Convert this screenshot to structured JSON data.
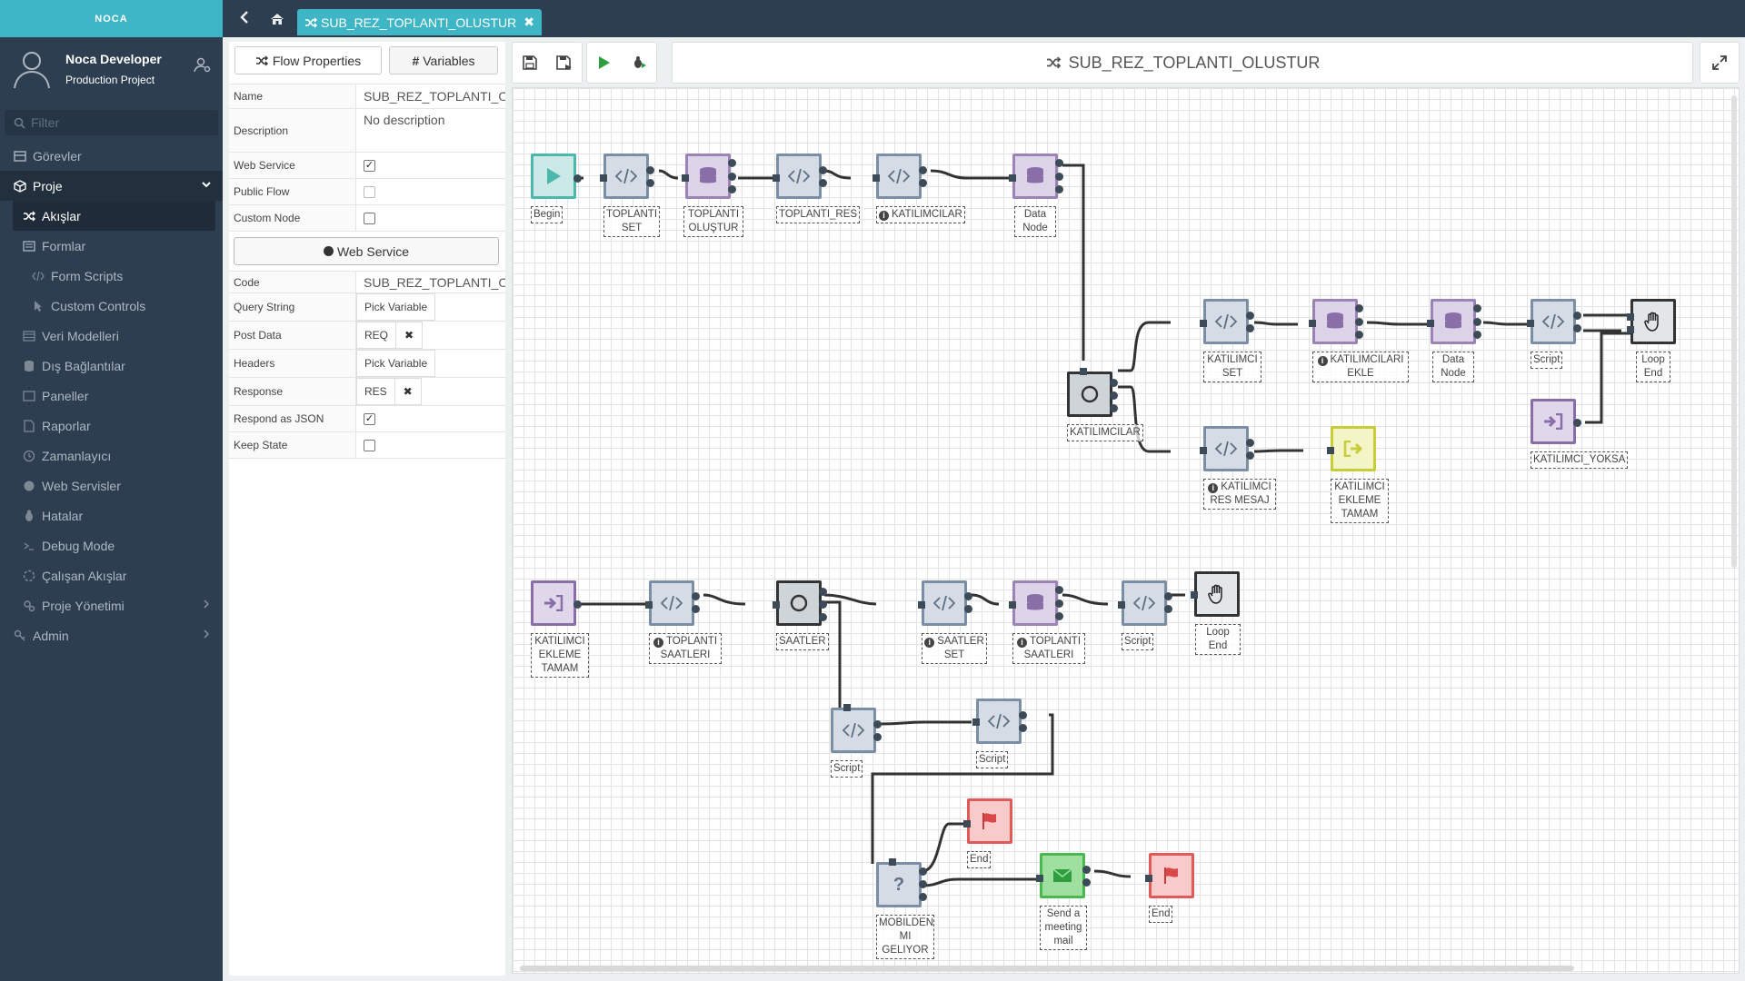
{
  "brand": "NOCA",
  "user": {
    "name": "Noca Developer",
    "project": "Production Project"
  },
  "filter_placeholder": "Filter",
  "nav": {
    "gorevler": "Görevler",
    "proje": "Proje",
    "akislar": "Akışlar",
    "formlar": "Formlar",
    "form_scripts": "Form Scripts",
    "custom_controls": "Custom Controls",
    "veri_modelleri": "Veri Modelleri",
    "dis_baglantilar": "Dış Bağlantılar",
    "paneller": "Paneller",
    "raporlar": "Raporlar",
    "zamanlayici": "Zamanlayıcı",
    "web_servisler": "Web Servisler",
    "hatalar": "Hatalar",
    "debug_mode": "Debug Mode",
    "calisan_akislar": "Çalışan Akışlar",
    "proje_yonetimi": "Proje Yönetimi",
    "admin": "Admin"
  },
  "tab": {
    "label": "SUB_REZ_TOPLANTI_OLUSTUR"
  },
  "props": {
    "tab_flow": "Flow Properties",
    "tab_vars": "Variables",
    "name_label": "Name",
    "name_value": "SUB_REZ_TOPLANTI_OLUSTUR",
    "desc_label": "Description",
    "desc_value": "No description",
    "web_service_label": "Web Service",
    "web_service_checked": true,
    "public_flow_label": "Public Flow",
    "public_flow_checked": false,
    "custom_node_label": "Custom Node",
    "custom_node_checked": false,
    "ws_button": "Web Service",
    "code_label": "Code",
    "code_value": "SUB_REZ_TOPLANTI_OLUSTUR",
    "query_label": "Query String",
    "query_value": "Pick Variable",
    "post_label": "Post Data",
    "post_value": "REQ",
    "headers_label": "Headers",
    "headers_value": "Pick Variable",
    "response_label": "Response",
    "response_value": "RES",
    "respond_json_label": "Respond as JSON",
    "respond_json_checked": true,
    "keep_state_label": "Keep State",
    "keep_state_checked": false
  },
  "flow_title": "SUB_REZ_TOPLANTI_OLUSTUR",
  "nodes": {
    "begin": "Begin",
    "toplanti_set": "TOPLANTI SET",
    "toplanti_olustur": "TOPLANTI OLUŞTUR",
    "toplanti_res": "TOPLANTI_RES",
    "katilimcilar_script": "KATILIMCILAR",
    "data_node_1": "Data Node",
    "katilimcilar_loop": "KATILIMCILAR",
    "katilimci_set": "KATILIMCI SET",
    "katilimcilari_ekle": "KATILIMCILARI EKLE",
    "data_node_2": "Data Node",
    "script_1": "Script",
    "loop_end_1": "Loop End",
    "katilimci_yoksa": "KATILIMCI_YOKSA",
    "katilimci_res_mesaj": "KATILIMCI RES MESAJ",
    "katilimci_ekleme_tamam_exit": "KATILIMCI EKLEME TAMAM",
    "katilimci_ekleme_tamam_enter": "KATILIMCI EKLEME TAMAM",
    "toplanti_saatleri_script": "TOPLANTI SAATLERI",
    "saatler": "SAATLER",
    "saatler_set": "SAATLER SET",
    "toplanti_saatleri_data": "TOPLANTI SAATLERI",
    "script_2": "Script",
    "loop_end_2": "Loop End",
    "script_3": "Script",
    "script_4": "Script",
    "end_1": "End",
    "mobilden": "MOBILDEN MI GELIYOR",
    "send_mail": "Send a meeting mail",
    "end_2": "End"
  }
}
